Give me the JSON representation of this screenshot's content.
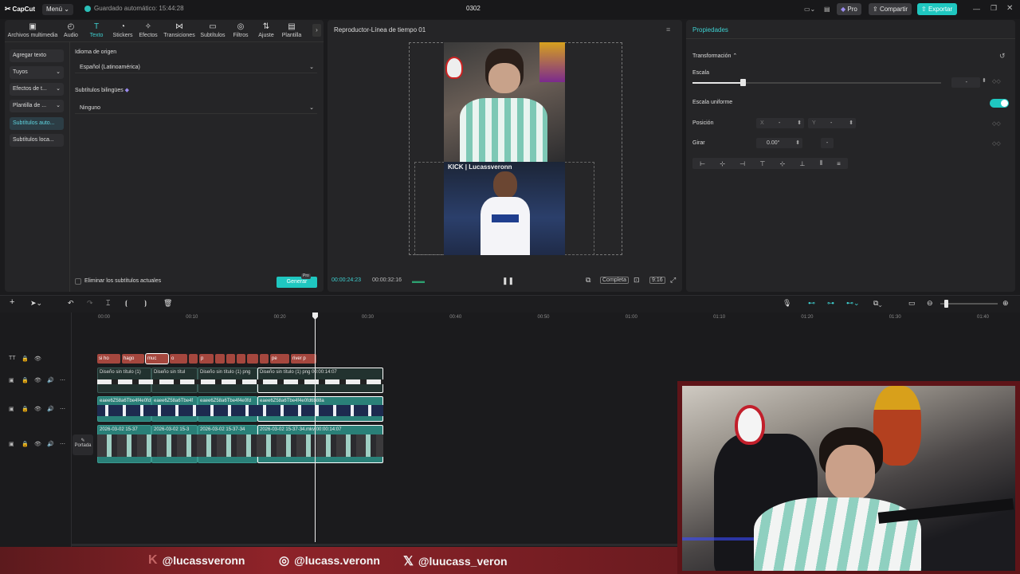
{
  "titlebar": {
    "app_name": "CapCut",
    "menu_label": "Menú",
    "autosave": "Guardado automático: 15:44:28",
    "project_name": "0302",
    "pro_label": "Pro",
    "share_label": "Compartir",
    "export_label": "Exportar"
  },
  "toolbar": {
    "items": [
      {
        "label": "Archivos multimedia",
        "icon": "media-icon"
      },
      {
        "label": "Audio",
        "icon": "audio-icon"
      },
      {
        "label": "Texto",
        "icon": "text-icon"
      },
      {
        "label": "Stickers",
        "icon": "sticker-icon"
      },
      {
        "label": "Efectos",
        "icon": "effects-icon"
      },
      {
        "label": "Transiciones",
        "icon": "transition-icon"
      },
      {
        "label": "Subtítulos",
        "icon": "subtitles-icon"
      },
      {
        "label": "Filtros",
        "icon": "filter-icon"
      },
      {
        "label": "Ajuste",
        "icon": "adjust-icon"
      },
      {
        "label": "Plantilla",
        "icon": "template-icon"
      }
    ]
  },
  "sidebar": {
    "items": [
      "Agregar texto",
      "Tuyos",
      "Efectos de t...",
      "Plantilla de ...",
      "Subtítulos auto...",
      "Subtítulos loca..."
    ]
  },
  "caption_panel": {
    "source_language_label": "Idioma de origen",
    "source_language_value": "Español (Latinoamérica)",
    "bilingual_label": "Subtítulos bilingües",
    "bilingual_value": "Ninguno",
    "remove_current_label": "Eliminar los subtítulos actuales",
    "generate_label": "Generar",
    "generate_badge": "Pro"
  },
  "player": {
    "title": "Reproductor-Línea de tiempo 01",
    "current_time": "00:00:24:23",
    "total_time": "00:00:32:16",
    "full_label": "Completa",
    "ratio_label": "9:16",
    "watermark": "KICK | Lucassveronn"
  },
  "properties": {
    "title": "Propiedades",
    "transform_label": "Transformación",
    "scale_label": "Escala",
    "scale_value": "-",
    "uniform_scale_label": "Escala uniforme",
    "position_label": "Posición",
    "pos_x_label": "X",
    "pos_x_value": "-",
    "pos_y_label": "Y",
    "pos_y_value": "-",
    "rotate_label": "Girar",
    "rotate_value": "0.00°",
    "rotate_dash": "-"
  },
  "timeline": {
    "ruler": [
      "00:00",
      "00:10",
      "00:20",
      "00:30",
      "00:40",
      "00:50",
      "01:00",
      "01:10",
      "01:20",
      "01:30",
      "01:40"
    ],
    "cover_label": "Portada",
    "subtitle_clips": [
      "si ho",
      "hago",
      "muc",
      "o",
      "",
      "p",
      "",
      "",
      "",
      "",
      "",
      "pe",
      "river p"
    ],
    "track1": [
      {
        "label": "Diseño sin título (1)"
      },
      {
        "label": "Diseño sin títul"
      },
      {
        "label": "Diseño sin título (1) png"
      },
      {
        "label": "Diseño sin título (1) png",
        "duration": "00:00:14:07"
      }
    ],
    "track2": [
      {
        "label": "eaee6Z58a6Tbe4f4e0fd"
      },
      {
        "label": "eaee6Z58a6Tbe4f"
      },
      {
        "label": "eaee6Z58a6Tbe4f4e0fd"
      },
      {
        "label": "eaee6Z58a6Tbe4f4e0fd6b88a"
      }
    ],
    "track3": [
      {
        "label": "2026-03-02 15-37"
      },
      {
        "label": "2026-03-02 15-3"
      },
      {
        "label": "2026-03-02 15-37-34"
      },
      {
        "label": "2026-03-02 15-37-34.mkv",
        "duration": "00:00:14:07"
      }
    ]
  },
  "overlay": {
    "socials": [
      {
        "icon": "kick-icon",
        "handle": "@lucassveronn"
      },
      {
        "icon": "instagram-icon",
        "handle": "@lucass.veronn"
      },
      {
        "icon": "x-icon",
        "handle": "@luucass_veron"
      }
    ]
  },
  "colors": {
    "accent": "#3ed0d0",
    "export": "#1fc7c0",
    "subtitle_clip": "#a5473e",
    "video_clip": "#2a8078"
  }
}
